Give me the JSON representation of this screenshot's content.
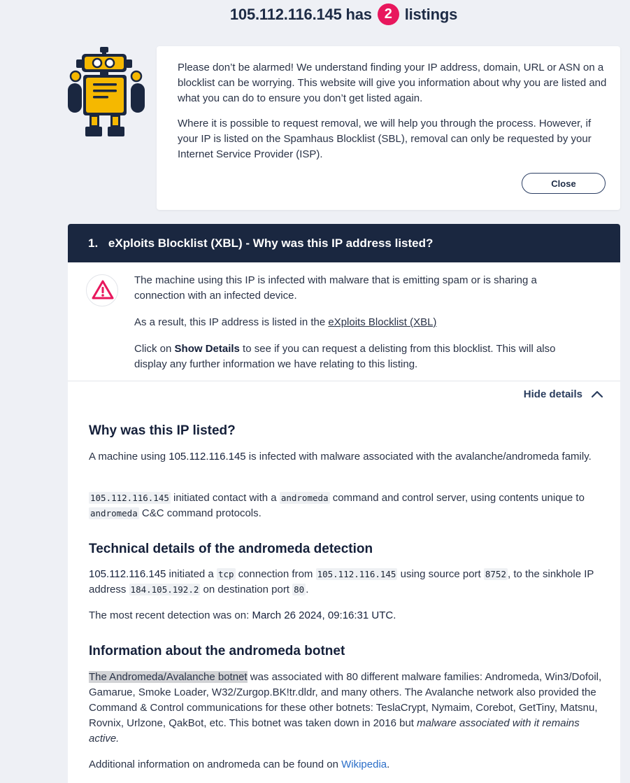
{
  "header": {
    "ip": "105.112.116.145",
    "has": "has",
    "count": "2",
    "listings": "listings"
  },
  "notice": {
    "paragraph1": "Please don’t be alarmed! We understand finding your IP address, domain, URL or ASN on a blocklist can be worrying. This website will give you information about why you are listed and what you can do to ensure you don’t get listed again.",
    "paragraph2": "Where it is possible to request removal, we will help you through the process. However, if your IP is listed on the Spamhaus Blocklist (SBL), removal can only be requested by your Internet Service Provider (ISP).",
    "close_label": "Close"
  },
  "listing": {
    "number": "1.",
    "title": "eXploits Blocklist (XBL) - Why was this IP address listed?",
    "summary1": "The machine using this IP is infected with malware that is emitting spam or is sharing a connection with an infected device.",
    "summary2_prefix": "As a result, this IP address is listed in the ",
    "summary2_link": "eXploits Blocklist (XBL)",
    "summary3_prefix": "Click on ",
    "summary3_bold": "Show Details",
    "summary3_suffix": " to see if you can request a delisting from this blocklist. This will also display any further information we have relating to this listing.",
    "hide_details_label": "Hide details"
  },
  "details": {
    "why_heading": "Why was this IP listed?",
    "why_p1_prefix": "A machine using ",
    "why_p1_ip": "105.112.116.145",
    "why_p1_suffix": " is infected with malware associated with the avalanche/andromeda family.",
    "why_p2_code_ip": "105.112.116.145",
    "why_p2_mid1": " initiated contact with a ",
    "why_p2_code_andromeda": "andromeda",
    "why_p2_mid2": " command and control server, using contents unique to ",
    "why_p2_code_andromeda2": "andromeda",
    "why_p2_suffix": " C&C command protocols.",
    "tech_heading": "Technical details of the andromeda detection",
    "tech_ip": "105.112.116.145",
    "tech_t1": " initiated a ",
    "tech_proto": "tcp",
    "tech_t2": " connection from ",
    "tech_src_ip": "105.112.116.145",
    "tech_t3": " using source port ",
    "tech_src_port": "8752",
    "tech_t4": ", to the sinkhole IP address ",
    "tech_sinkhole": "184.105.192.2",
    "tech_t5": " on destination port ",
    "tech_dst_port": "80",
    "tech_t6": ".",
    "recent_prefix": "The most recent detection was on: ",
    "recent_date": "March 26 2024, 09:16:31 UTC.",
    "info_heading": "Information about the andromeda botnet",
    "info_highlight": "The Andromeda/Avalanche botnet",
    "info_body": " was associated with 80 different malware families: Andromeda, Win3/Dofoil, Gamarue, Smoke Loader, W32/Zurgop.BK!tr.dldr, and many others. The Avalanche network also provided the Command & Control communications for these other botnets: TeslaCrypt, Nymaim, Corebot, GetTiny, Matsnu, Rovnix, Urlzone, QakBot, etc. This botnet was taken down in 2016 but ",
    "info_italic": "malware associated with it remains active.",
    "additional_prefix": "Additional information on andromeda can be found on ",
    "additional_link": "Wikipedia",
    "additional_suffix": "."
  },
  "colors": {
    "page_bg": "#eef0f5",
    "header_bar": "#1a2740",
    "badge": "#e8175d",
    "warning": "#e8175d",
    "robot_body": "#f5b800",
    "link": "#2a6ec8"
  },
  "icons": {
    "robot": "robot-mascot-icon",
    "warning": "warning-triangle-icon",
    "chevron": "chevron-up-icon"
  }
}
